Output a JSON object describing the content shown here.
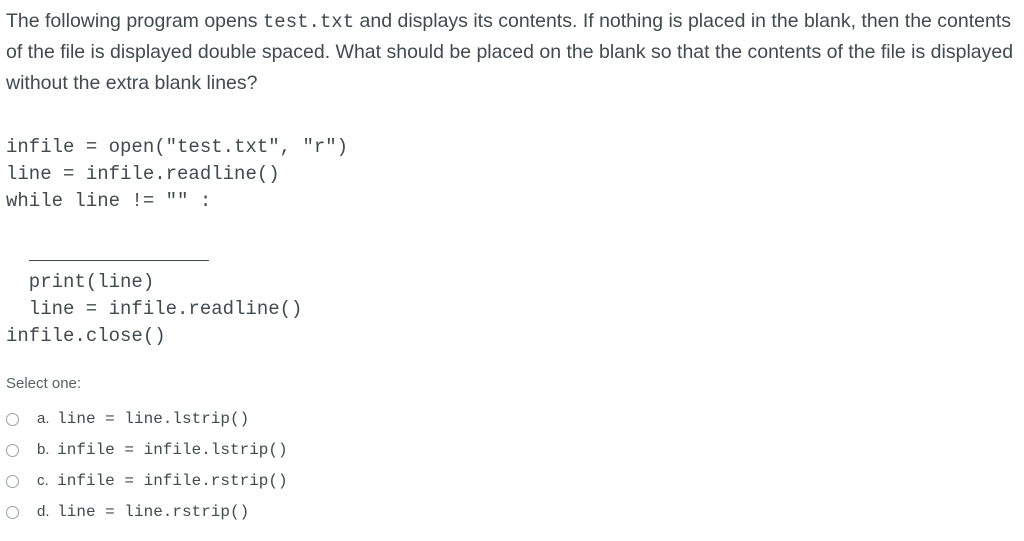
{
  "stem": {
    "part1": "The following program opens ",
    "mono1": "test.txt",
    "part2": " and displays its contents. If nothing is placed in the blank, then the contents of the file is displayed double spaced. What should be placed on the blank so that the contents of the file is displayed without the extra blank lines?"
  },
  "code": {
    "l1": "infile = open(\"test.txt\", \"r\")",
    "l2": "line = infile.readline()",
    "l3": "while line != \"\" :",
    "l4_indent": "   ",
    "l4": "print(line)",
    "l5": "line = infile.readline()",
    "l6": "infile.close()"
  },
  "select_one": "Select one:",
  "options": [
    {
      "letter": "a.",
      "text": "line = line.lstrip()"
    },
    {
      "letter": "b.",
      "text": "infile = infile.lstrip()"
    },
    {
      "letter": "c.",
      "text": "infile = infile.rstrip()"
    },
    {
      "letter": "d.",
      "text": "line = line.rstrip()"
    }
  ]
}
